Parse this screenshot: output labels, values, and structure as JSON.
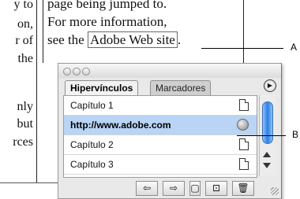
{
  "document": {
    "left_column_lines": [
      "y to",
      "on,",
      "r of",
      "the",
      "nly",
      "but",
      "rces"
    ],
    "right_column_lines": [
      "page being jumped to.",
      "For more information,",
      "see the ",
      "Adobe Web site",
      "."
    ]
  },
  "callouts": {
    "a_label": "A",
    "b_label": "B"
  },
  "panel": {
    "tabs": [
      {
        "label": "Hipervínculos"
      },
      {
        "label": "Marcadores"
      }
    ],
    "menu_icon": "▶",
    "rows": [
      {
        "label": "Capítulo 1"
      },
      {
        "label": "http://www.adobe.com"
      },
      {
        "label": "Capítulo 2"
      },
      {
        "label": "Capítulo 3"
      }
    ],
    "toolbar": {
      "back": "⇦",
      "forward": "⇨",
      "create": "▢",
      "new": "⊡",
      "delete": "🗑"
    }
  }
}
